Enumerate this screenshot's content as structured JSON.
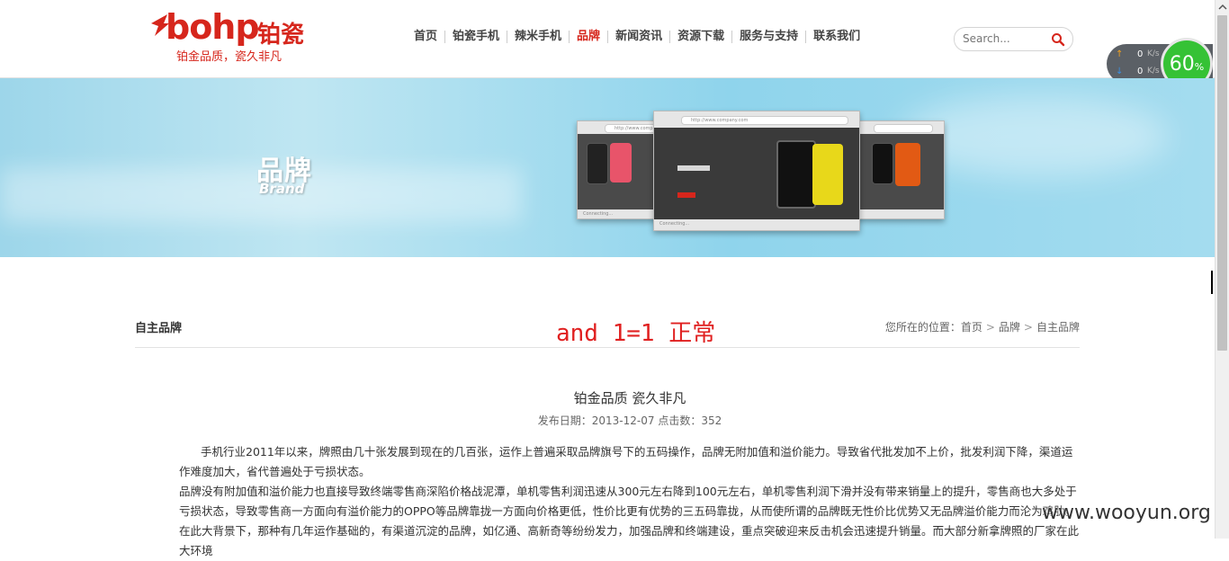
{
  "header": {
    "logo_text": "bohp",
    "logo_cn": "铂瓷",
    "tagline": "铂金品质，瓷久非凡",
    "nav": [
      {
        "label": "首页",
        "active": false
      },
      {
        "label": "铂瓷手机",
        "active": false
      },
      {
        "label": "辣米手机",
        "active": false
      },
      {
        "label": "品牌",
        "active": true
      },
      {
        "label": "新闻资讯",
        "active": false
      },
      {
        "label": "资源下载",
        "active": false
      },
      {
        "label": "服务与支持",
        "active": false
      },
      {
        "label": "联系我们",
        "active": false
      }
    ],
    "search": {
      "placeholder": "Search...",
      "icon": "search-icon"
    },
    "accent_color": "#d6261c"
  },
  "speed_widget": {
    "up_value": "0",
    "up_unit": "K/s",
    "down_value": "0",
    "down_unit": "K/s",
    "percent": "60",
    "percent_sign": "%"
  },
  "banner": {
    "title_cn": "品牌",
    "title_en": "Brand",
    "window_url": "http://www.company.com",
    "window_footer": "Connecting..."
  },
  "section": {
    "title": "自主品牌",
    "injected_text": "and 1=1 正常",
    "breadcrumb_prefix": "您所在的位置：",
    "breadcrumb": [
      "首页",
      "品牌",
      "自主品牌"
    ]
  },
  "article": {
    "title": "铂金品质 瓷久非凡",
    "meta": "发布日期：2013-12-07 点击数：352",
    "paragraphs": [
      "手机行业2011年以来，牌照由几十张发展到现在的几百张，运作上普遍采取品牌旗号下的五码操作，品牌无附加值和溢价能力。导致省代批发加不上价，批发利润下降，渠道运作难度加大，省代普遍处于亏损状态。",
      "品牌没有附加值和溢价能力也直接导致终端零售商深陷价格战泥潭，单机零售利润迅速从300元左右降到100元左右，单机零售利润下滑并没有带来销量上的提升，零售商也大多处于亏损状态，导致零售商一方面向有溢价能力的OPPO等品牌靠拢一方面向价格更低，性价比更有优势的三五码靠拢，从而使所谓的品牌既无性价比优势又无品牌溢价能力而沦为鸡肋。",
      "在此大背景下，那种有几年运作基础的，有渠道沉淀的品牌，如亿通、高新奇等纷纷发力，加强品牌和终端建设，重点突破迎来反击机会迅速提升销量。而大部分新拿牌照的厂家在此大环境"
    ]
  },
  "watermark": "www.wooyun.org"
}
